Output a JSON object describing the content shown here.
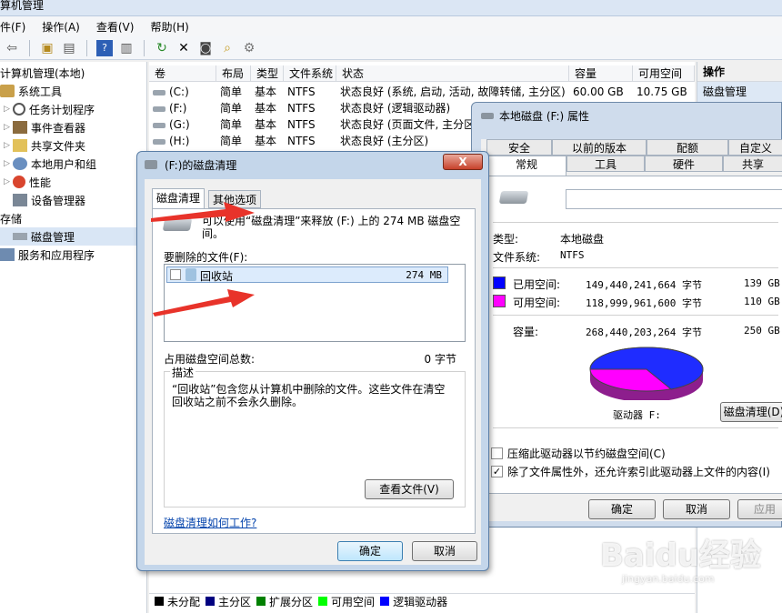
{
  "titlebar": {
    "title": "算机管理"
  },
  "menu": [
    "件(F)",
    "操作(A)",
    "查看(V)",
    "帮助(H)"
  ],
  "tree": {
    "items": [
      {
        "label": "计算机管理(本地)",
        "indent": 0,
        "icon": "computer-icon"
      },
      {
        "label": "系统工具",
        "indent": 1,
        "icon": "tools-icon"
      },
      {
        "label": "任务计划程序",
        "indent": 2,
        "icon": "clock-icon"
      },
      {
        "label": "事件查看器",
        "indent": 2,
        "icon": "event-icon"
      },
      {
        "label": "共享文件夹",
        "indent": 2,
        "icon": "folder-icon"
      },
      {
        "label": "本地用户和组",
        "indent": 2,
        "icon": "users-icon"
      },
      {
        "label": "性能",
        "indent": 2,
        "icon": "performance-icon"
      },
      {
        "label": "设备管理器",
        "indent": 2,
        "icon": "device-icon"
      },
      {
        "label": "存储",
        "indent": 0,
        "icon": "storage-icon"
      },
      {
        "label": "磁盘管理",
        "indent": 2,
        "icon": "disk-icon"
      },
      {
        "label": "服务和应用程序",
        "indent": 1,
        "icon": "services-icon"
      }
    ]
  },
  "grid": {
    "headers": [
      "卷",
      "布局",
      "类型",
      "文件系统",
      "状态",
      "容量",
      "可用空间"
    ],
    "rows": [
      [
        "(C:)",
        "简单",
        "基本",
        "NTFS",
        "状态良好 (系统, 启动, 活动, 故障转储, 主分区)",
        "60.00 GB",
        "10.75 GB"
      ],
      [
        "(F:)",
        "简单",
        "基本",
        "NTFS",
        "状态良好 (逻辑驱动器)",
        "",
        ""
      ],
      [
        "(G:)",
        "简单",
        "基本",
        "NTFS",
        "状态良好 (页面文件, 主分区",
        "",
        ""
      ],
      [
        "(H:)",
        "简单",
        "基本",
        "NTFS",
        "状态良好 (主分区)",
        "",
        ""
      ]
    ],
    "legend": [
      {
        "label": "未分配",
        "color": "#000000"
      },
      {
        "label": "主分区",
        "color": "#000080"
      },
      {
        "label": "扩展分区",
        "color": "#008000"
      },
      {
        "label": "可用空间",
        "color": "#00ff00"
      },
      {
        "label": "逻辑驱动器",
        "color": "#0000ff"
      }
    ]
  },
  "actions": {
    "header": "操作",
    "item": "磁盘管理"
  },
  "props": {
    "title": "本地磁盘 (F:) 属性",
    "tabs_row1": [
      "安全",
      "以前的版本",
      "配额",
      "自定义"
    ],
    "tabs_row2": [
      "常规",
      "工具",
      "硬件",
      "共享"
    ],
    "type_label": "类型:",
    "type_value": "本地磁盘",
    "fs_label": "文件系统:",
    "fs_value": "NTFS",
    "used_label": "已用空间:",
    "used_bytes": "149,440,241,664 字节",
    "used_gb": "139 GB",
    "used_color": "#0000ff",
    "free_label": "可用空间:",
    "free_bytes": "118,999,961,600 字节",
    "free_gb": "110 GB",
    "free_color": "#ff00ff",
    "cap_label": "容量:",
    "cap_bytes": "268,440,203,264 字节",
    "cap_gb": "250 GB",
    "drive_label": "驱动器 F:",
    "cleanup_button": "磁盘清理(D)",
    "compress_label": "压缩此驱动器以节约磁盘空间(C)",
    "index_label": "除了文件属性外，还允许索引此驱动器上文件的内容(I)",
    "ok": "确定",
    "cancel": "取消",
    "apply": "应用"
  },
  "clean": {
    "title": "(F:)的磁盘清理",
    "close": "X",
    "tabs": [
      "磁盘清理",
      "其他选项"
    ],
    "intro": "可以使用“磁盘清理”来释放  (F:) 上的 274 MB 磁盘空间。",
    "files_label": "要删除的文件(F):",
    "file_name": "回收站",
    "file_size": "274 MB",
    "total_label": "占用磁盘空间总数:",
    "total_value": "0 字节",
    "desc_label": "描述",
    "desc_text": "“回收站”包含您从计算机中删除的文件。这些文件在清空回收站之前不会永久删除。",
    "view_files": "查看文件(V)",
    "help_link": "磁盘清理如何工作?",
    "ok": "确定",
    "cancel": "取消"
  },
  "watermark": {
    "brand": "Baidu经验",
    "url": "jingyan.baidu.com"
  }
}
